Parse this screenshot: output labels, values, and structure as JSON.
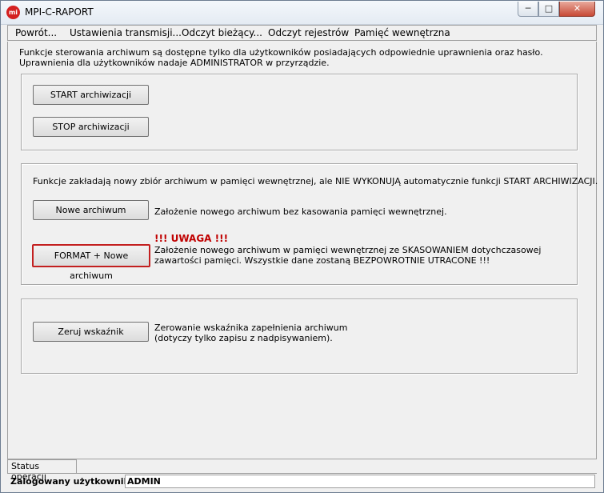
{
  "window": {
    "title": "MPI-C-RAPORT",
    "icon_text": "mi",
    "minimize_glyph": "─",
    "maximize_glyph": "□",
    "close_glyph": "✕"
  },
  "menu": {
    "items": [
      {
        "label": "Powrót..."
      },
      {
        "label": "Ustawienia transmisji..."
      },
      {
        "label": "Odczyt bieżący..."
      },
      {
        "label": "Odczyt rejestrów"
      },
      {
        "label": "Pamięć wewnętrzna"
      }
    ]
  },
  "intro": {
    "line1": "Funkcje sterowania archiwum są dostępne tylko dla użytkowników posiadających odpowiednie uprawnienia oraz hasło.",
    "line2": "Uprawnienia dla użytkowników nadaje ADMINISTRATOR w przyrządzie."
  },
  "archive_control": {
    "start_label": "START archiwizacji",
    "stop_label": "STOP archiwizacji"
  },
  "new_archive": {
    "info": "Funkcje zakładają nowy zbiór archiwum w pamięci wewnętrznej, ale NIE WYKONUJĄ automatycznie funkcji START ARCHIWIZACJI.",
    "new_button": "Nowe archiwum",
    "new_desc": "Założenie nowego archiwum bez kasowania pamięci wewnętrznej.",
    "warning": "!!! UWAGA !!!",
    "format_button": "FORMAT + Nowe archiwum",
    "format_desc_line1": "Założenie nowego archiwum w pamięci wewnętrznej ze SKASOWANIEM dotychczasowej",
    "format_desc_line2": "zawartości pamięci. Wszystkie dane zostaną BEZPOWROTNIE UTRACONE !!!"
  },
  "indicator": {
    "reset_button": "Zeruj wskaźnik",
    "desc_line1": "Zerowanie wskaźnika zapełnienia archiwum",
    "desc_line2": "(dotyczy tylko zapisu z nadpisywaniem)."
  },
  "status": {
    "tab_label": "Status operacji",
    "user_label": "Zalogowany użytkownik",
    "user_value": "ADMIN"
  },
  "colors": {
    "danger": "#c32020",
    "warning_text": "#c00000"
  }
}
